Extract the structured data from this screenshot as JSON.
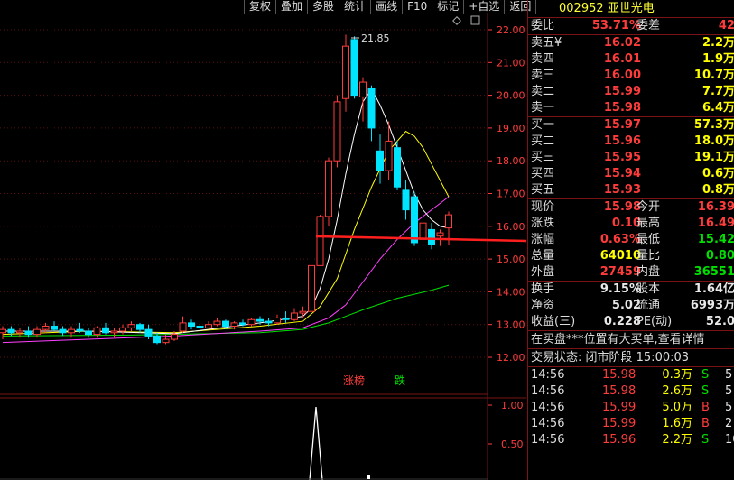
{
  "toolbar": {
    "items": [
      "复权",
      "叠加",
      "多股",
      "统计",
      "画线",
      "F10",
      "标记",
      "+自选",
      "返回"
    ]
  },
  "chart": {
    "price_labels": [
      "22.00",
      "21.00",
      "20.00",
      "19.00",
      "18.00",
      "17.00",
      "16.00",
      "15.00",
      "14.00",
      "13.00",
      "12.00"
    ],
    "price_values": [
      22,
      21,
      20,
      19,
      18,
      17,
      16,
      15,
      14,
      13,
      12
    ],
    "high_marker": "21.85",
    "vol_labels": [
      "1.00",
      "0.50"
    ],
    "tag_zhangbang": "涨榜",
    "tag_die": "跌",
    "colors": {
      "up": "#ff3c3c",
      "down": "#00e5ff",
      "ma5": "#ffffff",
      "ma10": "#ffff00",
      "ma20": "#ff40ff",
      "ma60": "#00e000",
      "trend": "#ff1f1f"
    }
  },
  "quote": {
    "code": "002952",
    "name": "亚世光电",
    "weibi_label": "委比",
    "weibi_value": "53.71%",
    "weicha_label": "委差",
    "weicha_value": "42",
    "sell": [
      {
        "label": "卖五",
        "sub": "¥",
        "price": "16.02",
        "vol": "2.2万"
      },
      {
        "label": "卖四",
        "sub": "",
        "price": "16.01",
        "vol": "1.9万"
      },
      {
        "label": "卖三",
        "sub": "",
        "price": "16.00",
        "vol": "10.7万"
      },
      {
        "label": "卖二",
        "sub": "",
        "price": "15.99",
        "vol": "7.7万"
      },
      {
        "label": "卖一",
        "sub": "",
        "price": "15.98",
        "vol": "6.4万"
      }
    ],
    "buy": [
      {
        "label": "买一",
        "price": "15.97",
        "vol": "57.3万"
      },
      {
        "label": "买二",
        "price": "15.96",
        "vol": "18.0万"
      },
      {
        "label": "买三",
        "price": "15.95",
        "vol": "19.1万"
      },
      {
        "label": "买四",
        "price": "15.94",
        "vol": "0.6万"
      },
      {
        "label": "买五",
        "price": "15.93",
        "vol": "0.8万"
      }
    ],
    "stats": [
      {
        "l1": "现价",
        "v1": "15.98",
        "c1": "red",
        "l2": "今开",
        "v2": "16.39",
        "c2": "red"
      },
      {
        "l1": "涨跌",
        "v1": "0.10",
        "c1": "red",
        "l2": "最高",
        "v2": "16.49",
        "c2": "red"
      },
      {
        "l1": "涨幅",
        "v1": "0.63%",
        "c1": "red",
        "l2": "最低",
        "v2": "15.42",
        "c2": "grn"
      },
      {
        "l1": "总量",
        "v1": "64010",
        "c1": "yel",
        "l2": "量比",
        "v2": "0.80",
        "c2": "grn"
      },
      {
        "l1": "外盘",
        "v1": "27459",
        "c1": "red",
        "l2": "内盘",
        "v2": "36551",
        "c2": "grn"
      }
    ],
    "stats2": [
      {
        "l1": "换手",
        "v1": "9.15%",
        "l2": "股本",
        "v2": "1.64亿"
      },
      {
        "l1": "净资",
        "v1": "5.02",
        "l2": "流通",
        "v2": "6993万"
      },
      {
        "l1": "收益(三)",
        "v1": "0.228",
        "l2": "PE(动)",
        "v2": "52.0"
      }
    ],
    "message": "在买盘***位置有大买单,查看详情",
    "status": "交易状态: 闭市阶段 15:00:03",
    "trades": [
      {
        "time": "14:56",
        "price": "15.98",
        "vol": "0.3万",
        "side": "S",
        "n": "5"
      },
      {
        "time": "14:56",
        "price": "15.98",
        "vol": "2.6万",
        "side": "S",
        "n": "5"
      },
      {
        "time": "14:56",
        "price": "15.99",
        "vol": "5.0万",
        "side": "B",
        "n": "5"
      },
      {
        "time": "14:56",
        "price": "15.99",
        "vol": "1.6万",
        "side": "B",
        "n": "2"
      },
      {
        "time": "14:56",
        "price": "15.96",
        "vol": "2.2万",
        "side": "S",
        "n": "10"
      }
    ]
  },
  "candles": [
    {
      "o": 12.75,
      "h": 12.95,
      "l": 12.55,
      "c": 12.85
    },
    {
      "o": 12.85,
      "h": 12.95,
      "l": 12.65,
      "c": 12.75
    },
    {
      "o": 12.75,
      "h": 12.9,
      "l": 12.6,
      "c": 12.8
    },
    {
      "o": 12.8,
      "h": 12.95,
      "l": 12.6,
      "c": 12.7
    },
    {
      "o": 12.7,
      "h": 12.95,
      "l": 12.6,
      "c": 12.85
    },
    {
      "o": 12.85,
      "h": 13.05,
      "l": 12.75,
      "c": 12.95
    },
    {
      "o": 12.95,
      "h": 13.1,
      "l": 12.8,
      "c": 12.85
    },
    {
      "o": 12.85,
      "h": 12.95,
      "l": 12.65,
      "c": 12.75
    },
    {
      "o": 12.75,
      "h": 12.95,
      "l": 12.6,
      "c": 12.85
    },
    {
      "o": 12.85,
      "h": 13.05,
      "l": 12.75,
      "c": 12.8
    },
    {
      "o": 12.8,
      "h": 12.9,
      "l": 12.6,
      "c": 12.7
    },
    {
      "o": 12.7,
      "h": 12.95,
      "l": 12.6,
      "c": 12.9
    },
    {
      "o": 12.9,
      "h": 13.05,
      "l": 12.7,
      "c": 12.75
    },
    {
      "o": 12.75,
      "h": 12.9,
      "l": 12.6,
      "c": 12.8
    },
    {
      "o": 12.8,
      "h": 13.0,
      "l": 12.7,
      "c": 12.9
    },
    {
      "o": 12.9,
      "h": 13.1,
      "l": 12.8,
      "c": 13.0
    },
    {
      "o": 13.0,
      "h": 13.05,
      "l": 12.75,
      "c": 12.85
    },
    {
      "o": 12.85,
      "h": 13.0,
      "l": 12.55,
      "c": 12.65
    },
    {
      "o": 12.65,
      "h": 12.75,
      "l": 12.4,
      "c": 12.45
    },
    {
      "o": 12.45,
      "h": 12.7,
      "l": 12.4,
      "c": 12.55
    },
    {
      "o": 12.55,
      "h": 12.8,
      "l": 12.5,
      "c": 12.7
    },
    {
      "o": 12.8,
      "h": 13.25,
      "l": 12.75,
      "c": 13.05
    },
    {
      "o": 13.05,
      "h": 13.15,
      "l": 12.85,
      "c": 12.95
    },
    {
      "o": 12.95,
      "h": 13.05,
      "l": 12.8,
      "c": 12.9
    },
    {
      "o": 12.9,
      "h": 13.1,
      "l": 12.85,
      "c": 13.0
    },
    {
      "o": 13.0,
      "h": 13.2,
      "l": 12.95,
      "c": 13.1
    },
    {
      "o": 13.1,
      "h": 13.15,
      "l": 12.85,
      "c": 12.95
    },
    {
      "o": 12.95,
      "h": 13.1,
      "l": 12.85,
      "c": 13.05
    },
    {
      "o": 13.05,
      "h": 13.15,
      "l": 12.95,
      "c": 13.0
    },
    {
      "o": 13.0,
      "h": 13.2,
      "l": 12.95,
      "c": 13.15
    },
    {
      "o": 13.15,
      "h": 13.25,
      "l": 13.0,
      "c": 13.1
    },
    {
      "o": 13.1,
      "h": 13.2,
      "l": 12.95,
      "c": 13.05
    },
    {
      "o": 13.05,
      "h": 13.3,
      "l": 13.0,
      "c": 13.2
    },
    {
      "o": 13.2,
      "h": 13.4,
      "l": 13.05,
      "c": 13.15
    },
    {
      "o": 13.15,
      "h": 13.5,
      "l": 13.1,
      "c": 13.35
    },
    {
      "o": 13.35,
      "h": 13.55,
      "l": 13.2,
      "c": 13.4
    },
    {
      "o": 13.4,
      "h": 14.8,
      "l": 13.4,
      "c": 14.8
    },
    {
      "o": 14.8,
      "h": 16.35,
      "l": 14.8,
      "c": 16.3
    },
    {
      "o": 16.3,
      "h": 18.1,
      "l": 16.0,
      "c": 18.0
    },
    {
      "o": 18.0,
      "h": 20.0,
      "l": 17.8,
      "c": 19.8
    },
    {
      "o": 19.9,
      "h": 21.85,
      "l": 19.5,
      "c": 21.5
    },
    {
      "o": 21.7,
      "h": 21.8,
      "l": 19.9,
      "c": 20.0
    },
    {
      "o": 19.95,
      "h": 20.55,
      "l": 19.2,
      "c": 20.4
    },
    {
      "o": 20.2,
      "h": 20.3,
      "l": 18.6,
      "c": 19.0
    },
    {
      "o": 18.3,
      "h": 18.8,
      "l": 17.3,
      "c": 17.7
    },
    {
      "o": 17.7,
      "h": 19.2,
      "l": 17.4,
      "c": 18.6
    },
    {
      "o": 18.4,
      "h": 18.6,
      "l": 17.1,
      "c": 17.2
    },
    {
      "o": 17.1,
      "h": 17.4,
      "l": 16.2,
      "c": 16.5
    },
    {
      "o": 16.9,
      "h": 17.05,
      "l": 15.4,
      "c": 15.5
    },
    {
      "o": 15.6,
      "h": 16.4,
      "l": 15.4,
      "c": 16.1
    },
    {
      "o": 15.9,
      "h": 16.1,
      "l": 15.3,
      "c": 15.45
    },
    {
      "o": 15.7,
      "h": 15.9,
      "l": 15.4,
      "c": 15.8
    },
    {
      "o": 15.95,
      "h": 16.45,
      "l": 15.42,
      "c": 16.35
    }
  ],
  "ma": {
    "ma5": [
      [
        0,
        12.8
      ],
      [
        10,
        12.8
      ],
      [
        20,
        12.72
      ],
      [
        30,
        13.05
      ],
      [
        35,
        13.25
      ],
      [
        36,
        13.5
      ],
      [
        37,
        14.1
      ],
      [
        38,
        15.0
      ],
      [
        39,
        16.2
      ],
      [
        40,
        17.6
      ],
      [
        41,
        18.8
      ],
      [
        42,
        19.8
      ],
      [
        43,
        20.2
      ],
      [
        44,
        19.7
      ],
      [
        45,
        19.1
      ],
      [
        46,
        18.4
      ],
      [
        47,
        17.7
      ],
      [
        48,
        17.0
      ],
      [
        49,
        16.5
      ],
      [
        50,
        16.2
      ],
      [
        51,
        16.0
      ],
      [
        52,
        15.95
      ]
    ],
    "ma10": [
      [
        0,
        12.7
      ],
      [
        10,
        12.8
      ],
      [
        20,
        12.75
      ],
      [
        30,
        12.95
      ],
      [
        35,
        13.1
      ],
      [
        37,
        13.55
      ],
      [
        39,
        14.4
      ],
      [
        41,
        15.9
      ],
      [
        43,
        17.2
      ],
      [
        45,
        18.3
      ],
      [
        47,
        18.9
      ],
      [
        48,
        18.75
      ],
      [
        49,
        18.4
      ],
      [
        50,
        17.9
      ],
      [
        51,
        17.4
      ],
      [
        52,
        16.9
      ]
    ],
    "ma20": [
      [
        0,
        12.45
      ],
      [
        10,
        12.55
      ],
      [
        20,
        12.65
      ],
      [
        30,
        12.8
      ],
      [
        35,
        12.9
      ],
      [
        38,
        13.2
      ],
      [
        40,
        13.6
      ],
      [
        42,
        14.3
      ],
      [
        44,
        15.0
      ],
      [
        46,
        15.6
      ],
      [
        48,
        16.1
      ],
      [
        50,
        16.5
      ],
      [
        52,
        16.9
      ]
    ],
    "ma60": [
      [
        0,
        12.65
      ],
      [
        15,
        12.68
      ],
      [
        30,
        12.75
      ],
      [
        35,
        12.85
      ],
      [
        38,
        13.05
      ],
      [
        42,
        13.45
      ],
      [
        46,
        13.8
      ],
      [
        50,
        14.05
      ],
      [
        52,
        14.2
      ]
    ]
  },
  "trend": [
    [
      350,
      262
    ],
    [
      583,
      267
    ]
  ]
}
